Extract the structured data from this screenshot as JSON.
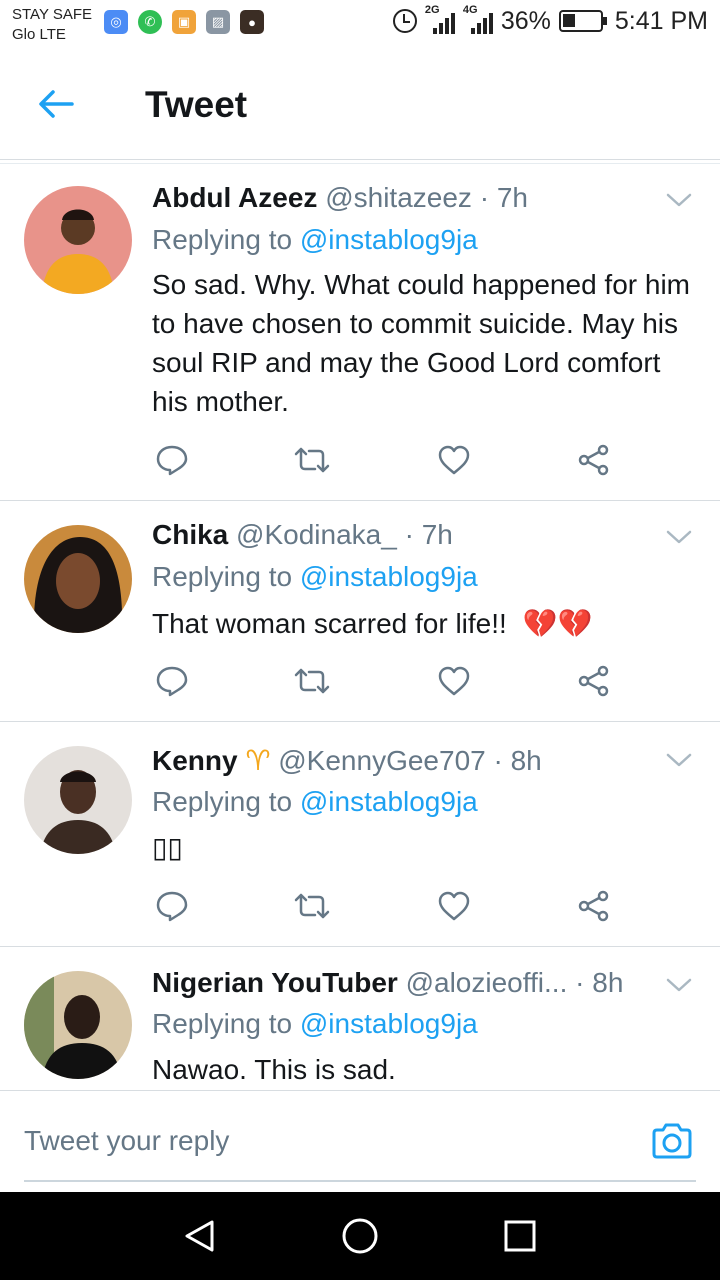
{
  "status_bar": {
    "carrier_line1": "STAY SAFE",
    "carrier_line2": "Glo LTE",
    "network1": "2G",
    "network2": "4G",
    "battery": "36%",
    "time": "5:41 PM",
    "app_icons": [
      "messenger-icon",
      "whatsapp-icon",
      "lock-app-icon",
      "gallery-icon",
      "profile-photo-icon"
    ]
  },
  "header": {
    "title": "Tweet"
  },
  "tweets": [
    {
      "name": "Abdul Azeez",
      "handle": "@shitazeez",
      "dot": "·",
      "time": "7h",
      "replying_prefix": "Replying to",
      "replying_to": "@instablog9ja",
      "text": "So sad. Why. What could happened for him to have chosen to commit suicide. May his soul RIP and may the Good Lord comfort his mother.",
      "avatar_color": "#e8938a"
    },
    {
      "name": "Chika",
      "handle": "@Kodinaka_",
      "dot": "·",
      "time": "7h",
      "replying_prefix": "Replying to",
      "replying_to": "@instablog9ja",
      "text": "That woman scarred for life!!",
      "emoji": "💔💔",
      "avatar_color": "#5a3b2a"
    },
    {
      "name": "Kenny",
      "name_emoji": "♈",
      "handle": "@KennyGee707",
      "dot": "·",
      "time": "8h",
      "replying_prefix": "Replying to",
      "replying_to": "@instablog9ja",
      "text": "▯▯",
      "avatar_color": "#d9d4cf"
    },
    {
      "name": "Nigerian YouTuber",
      "handle": "@alozieoffi...",
      "dot": "·",
      "time": "8h",
      "replying_prefix": "Replying to",
      "replying_to": "@instablog9ja",
      "text": "Nawao. This is sad.",
      "avatar_color": "#2b2b33"
    }
  ],
  "reply_bar": {
    "placeholder": "Tweet your reply"
  },
  "colors": {
    "twitter_blue": "#1da1f2",
    "secondary_text": "#657786",
    "primary_text": "#14171a",
    "divider": "#d8dde1"
  }
}
